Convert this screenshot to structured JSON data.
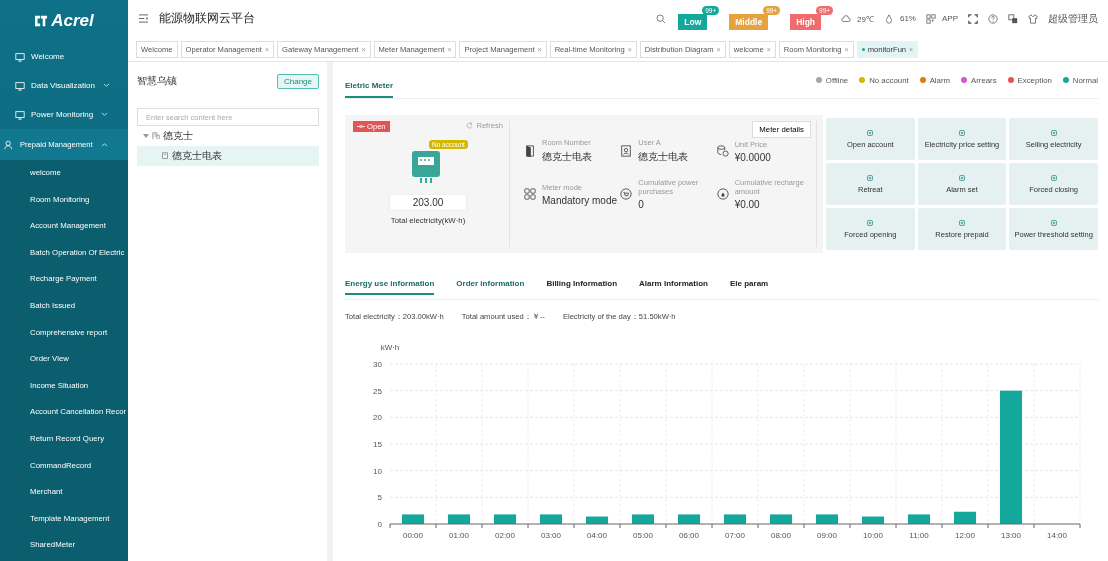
{
  "logo": "Acrel",
  "app_title": "能源物联网云平台",
  "alerts": [
    {
      "label": "Low",
      "count": "99+",
      "color": "#14a89c"
    },
    {
      "label": "Middle",
      "count": "99+",
      "color": "#e6a23c"
    },
    {
      "label": "High",
      "count": "99+",
      "color": "#f06c6c"
    }
  ],
  "weather": {
    "temperature": "29℃",
    "humidity": "61%"
  },
  "app_link": "APP",
  "user": "超级管理员",
  "sidebar": {
    "items": [
      {
        "label": "Welcome"
      },
      {
        "label": "Data Visualization",
        "expanded": false
      },
      {
        "label": "Power Monitoring",
        "expanded": false
      },
      {
        "label": "Prepaid Management",
        "expanded": true,
        "children": [
          {
            "label": "welcome"
          },
          {
            "label": "Room Monitoring"
          },
          {
            "label": "Account Management"
          },
          {
            "label": "Batch Operation Of Electric"
          },
          {
            "label": "Recharge Payment"
          },
          {
            "label": "Batch Issued"
          },
          {
            "label": "Comprehensive report"
          },
          {
            "label": "Order View"
          },
          {
            "label": "Income Situation"
          },
          {
            "label": "Account Cancellation Recor"
          },
          {
            "label": "Return Record Query"
          },
          {
            "label": "CommandRecord"
          },
          {
            "label": "Merchant"
          },
          {
            "label": "Template Management"
          },
          {
            "label": "SharedMeter"
          }
        ]
      }
    ]
  },
  "page_tabs": [
    {
      "label": "Welcome",
      "selected": false
    },
    {
      "label": "Operator Management",
      "close": "×",
      "selected": false
    },
    {
      "label": "Gateway Management",
      "close": "×",
      "selected": false
    },
    {
      "label": "Meter Management",
      "close": "×",
      "selected": false
    },
    {
      "label": "Project Management",
      "close": "×",
      "selected": false
    },
    {
      "label": "Real-time Monitoring",
      "close": "×",
      "selected": false
    },
    {
      "label": "Distribution Diagram",
      "close": "×",
      "selected": false
    },
    {
      "label": "welcome",
      "close": "×",
      "selected": false
    },
    {
      "label": "Room Monitoring",
      "close": "×",
      "selected": false
    },
    {
      "label": "monitorFun",
      "close": "×",
      "selected": true
    }
  ],
  "tree_panel": {
    "title": "智慧乌镇",
    "change_button": "Change",
    "search": {
      "placeholder": "Enter search content here"
    },
    "tree": [
      {
        "label": "德克士",
        "expanded": true,
        "selected": false,
        "children": [
          {
            "label": "德克士电表",
            "selected": false,
            "highlighted": true
          }
        ]
      }
    ]
  },
  "meter_tab": "Eletric Meter",
  "legend": [
    {
      "label": "Offline",
      "color": "#a6a6a6"
    },
    {
      "label": "No account",
      "color": "#d4b800"
    },
    {
      "label": "Alarm",
      "color": "#e07a10"
    },
    {
      "label": "Arrears",
      "color": "#d855d8"
    },
    {
      "label": "Exception",
      "color": "#e05555"
    },
    {
      "label": "Normal",
      "color": "#14a89c"
    }
  ],
  "meter": {
    "switch_state": "Open",
    "refresh": "Refresh",
    "account_badge": "No account",
    "total": "203.00",
    "total_caption": "Total electricity(kW·h)",
    "details_button": "Meter details",
    "fields": [
      {
        "label": "Room Number",
        "value": "德克士电表"
      },
      {
        "label": "User A",
        "value": "德克士电表"
      },
      {
        "label": "Unit Price",
        "value": "¥0.0000"
      },
      {
        "label": "Meter mode",
        "value": "Mandatory mode"
      },
      {
        "label": "Cumulative power purchases",
        "value": "0"
      },
      {
        "label": "Cumulative recharge amount",
        "value": "¥0.00"
      }
    ]
  },
  "actions": [
    "Open account",
    "Electricity price setting",
    "Selling electricity",
    "Retreat",
    "Alarm set",
    "Forced closing",
    "Forced opening",
    "Restore prepaid",
    "Power threshold setting"
  ],
  "info_tabs": [
    {
      "label": "Energy use information",
      "selected": true
    },
    {
      "label": "Order information",
      "selected": false
    },
    {
      "label": "Billing Information",
      "selected": false
    },
    {
      "label": "Alarm Information",
      "selected": false
    },
    {
      "label": "Ele param",
      "selected": false
    }
  ],
  "summary": [
    "Total electricity：203.00kW·h",
    "Total amount used：￥--",
    "Electricity of the day：51.50kW·h"
  ],
  "chart_data": {
    "type": "bar",
    "ylabel": "kW·h",
    "categories": [
      "00:00",
      "01:00",
      "02:00",
      "03:00",
      "04:00",
      "05:00",
      "06:00",
      "07:00",
      "08:00",
      "09:00",
      "10:00",
      "11:00",
      "12:00",
      "13:00",
      "14:00"
    ],
    "grid": true,
    "series": [
      {
        "color": "#14a89c",
        "values": [
          1.8,
          1.8,
          1.8,
          1.8,
          1.4,
          1.8,
          1.8,
          1.8,
          1.8,
          1.8,
          1.4,
          1.8,
          2.3,
          25,
          null
        ]
      }
    ],
    "ylim": [
      0,
      30
    ],
    "yticks": [
      0,
      5,
      10,
      15,
      20,
      25,
      30
    ]
  }
}
